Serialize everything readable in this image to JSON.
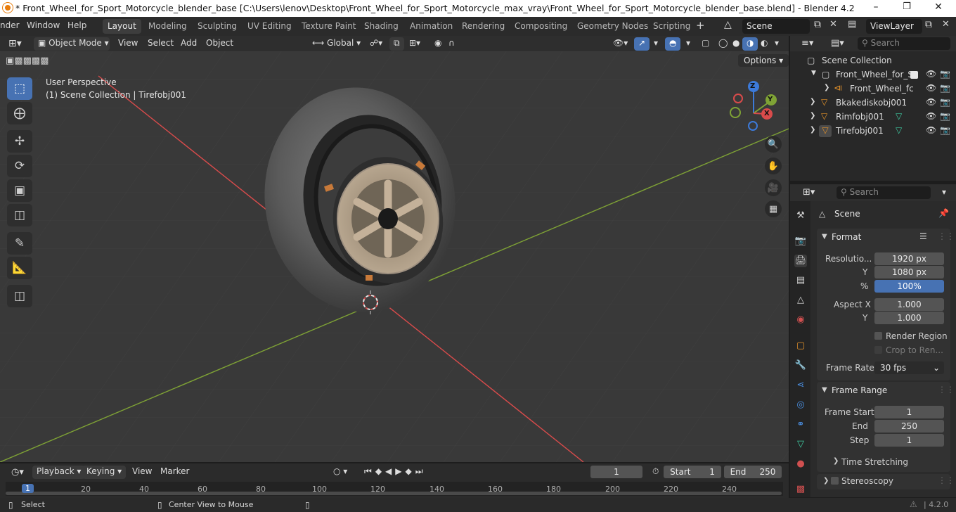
{
  "titlebar": {
    "title": "* Front_Wheel_for_Sport_Motorcycle_blender_base [C:\\Users\\lenov\\Desktop\\Front_Wheel_for_Sport_Motorcycle_max_vray\\Front_Wheel_for_Sport_Motorcycle_blender_base.blend] - Blender 4.2"
  },
  "menus": [
    "nder",
    "Window",
    "Help"
  ],
  "workspaces": [
    "Layout",
    "Modeling",
    "Sculpting",
    "UV Editing",
    "Texture Paint",
    "Shading",
    "Animation",
    "Rendering",
    "Compositing",
    "Geometry Nodes",
    "Scripting"
  ],
  "scene_field": "Scene",
  "viewlayer_field": "ViewLayer",
  "viewport_header": {
    "mode": "Object Mode",
    "view": "View",
    "select": "Select",
    "add": "Add",
    "object": "Object",
    "orientation": "Global"
  },
  "viewport": {
    "perspective": "User Perspective",
    "collection_info": "(1) Scene Collection | Tirefobj001",
    "options": "Options"
  },
  "gizmo": {
    "x": "X",
    "y": "Y",
    "z": "Z"
  },
  "outliner": {
    "search_placeholder": "Search",
    "root": "Scene Collection",
    "rows": [
      {
        "label": "Front_Wheel_for_S"
      },
      {
        "label": "Front_Wheel_fc"
      },
      {
        "label": "Bkakediskobj001"
      },
      {
        "label": "Rimfobj001"
      },
      {
        "label": "Tirefobj001"
      }
    ]
  },
  "properties": {
    "search_placeholder": "Search",
    "context": "Scene",
    "format": {
      "title": "Format",
      "resolution_label": "Resolutio...",
      "res_x": "1920 px",
      "y_label": "Y",
      "res_y": "1080 px",
      "pct_label": "%",
      "res_pct": "100%",
      "aspect_label": "Aspect X",
      "aspect_x": "1.000",
      "aspect_y_label": "Y",
      "aspect_y": "1.000",
      "render_region": "Render Region",
      "crop": "Crop to Ren...",
      "frame_rate_label": "Frame Rate",
      "frame_rate": "30 fps"
    },
    "frame_range": {
      "title": "Frame Range",
      "start_label": "Frame Start",
      "start": "1",
      "end_label": "End",
      "end": "250",
      "step_label": "Step",
      "step": "1"
    },
    "time_stretching": "Time Stretching",
    "stereoscopy": "Stereoscopy"
  },
  "timeline": {
    "playback": "Playback",
    "keying": "Keying",
    "view": "View",
    "marker": "Marker",
    "current_frame": "1",
    "start_label": "Start",
    "start": "1",
    "end_label": "End",
    "end": "250",
    "ticks": [
      "1",
      "20",
      "40",
      "60",
      "80",
      "100",
      "120",
      "140",
      "160",
      "180",
      "200",
      "220",
      "240"
    ]
  },
  "status": {
    "select": "Select",
    "center": "Center View to Mouse",
    "version": "4.2.0"
  },
  "colors": {
    "accent": "#4772b3",
    "x_axis": "#d94b4b",
    "y_axis": "#7fa335",
    "z_axis": "#3c7ad9",
    "bg": "#393939"
  }
}
